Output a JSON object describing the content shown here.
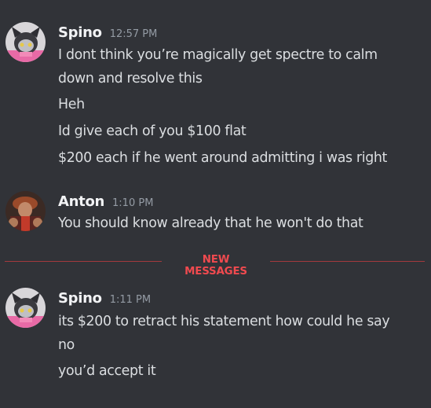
{
  "messages": [
    {
      "author": "Spino",
      "timestamp": "12:57 PM",
      "lines": [
        "I dont think you’re magically get spectre to calm",
        "down and resolve this",
        "Heh",
        "Id give each of you $100 flat",
        "$200 each if he went around admitting i was right"
      ]
    },
    {
      "author": "Anton",
      "timestamp": "1:10 PM",
      "lines": [
        "You should know already that he won't do that"
      ]
    },
    {
      "author": "Spino",
      "timestamp": "1:11 PM",
      "lines": [
        "its $200 to retract his statement how could he say",
        "no",
        "you’d accept it"
      ]
    }
  ],
  "divider": {
    "label": "NEW MESSAGES",
    "color": "#f04a4f"
  },
  "colors": {
    "background": "#313338",
    "author": "#f2f3f5",
    "timestamp": "#949ba4",
    "text": "#dbdee1"
  }
}
